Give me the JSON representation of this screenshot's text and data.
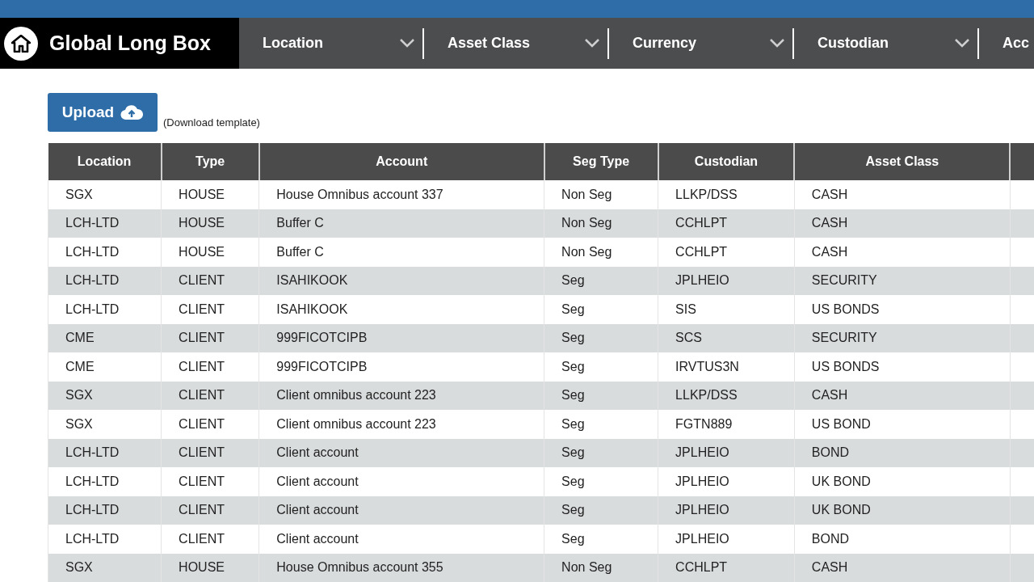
{
  "brand": {
    "title": "Global Long Box"
  },
  "filters": [
    {
      "label": "Location"
    },
    {
      "label": "Asset Class"
    },
    {
      "label": "Currency"
    },
    {
      "label": "Custodian"
    },
    {
      "label": "Acc"
    }
  ],
  "upload": {
    "label": "Upload",
    "link": "(Download template)"
  },
  "table": {
    "columns": [
      "Location",
      "Type",
      "Account",
      "Seg Type",
      "Custodian",
      "Asset Class"
    ],
    "rows": [
      [
        "SGX",
        "HOUSE",
        "House Omnibus account 337",
        "Non Seg",
        "LLKP/DSS",
        "CASH"
      ],
      [
        "LCH-LTD",
        "HOUSE",
        "Buffer C",
        "Non Seg",
        "CCHLPT",
        "CASH"
      ],
      [
        "LCH-LTD",
        "HOUSE",
        "Buffer C",
        "Non Seg",
        "CCHLPT",
        "CASH"
      ],
      [
        "LCH-LTD",
        "CLIENT",
        "ISAHIKOOK",
        "Seg",
        "JPLHEIO",
        "SECURITY"
      ],
      [
        "LCH-LTD",
        "CLIENT",
        "ISAHIKOOK",
        "Seg",
        "SIS",
        "US BONDS"
      ],
      [
        "CME",
        "CLIENT",
        "999FICOTCIPB",
        "Seg",
        "SCS",
        "SECURITY"
      ],
      [
        "CME",
        "CLIENT",
        "999FICOTCIPB",
        "Seg",
        "IRVTUS3N",
        "US BONDS"
      ],
      [
        "SGX",
        "CLIENT",
        "Client omnibus account 223",
        "Seg",
        "LLKP/DSS",
        "CASH"
      ],
      [
        "SGX",
        "CLIENT",
        "Client omnibus account 223",
        "Seg",
        "FGTN889",
        "US BOND"
      ],
      [
        "LCH-LTD",
        "CLIENT",
        "Client account",
        "Seg",
        "JPLHEIO",
        "BOND"
      ],
      [
        "LCH-LTD",
        "CLIENT",
        "Client account",
        "Seg",
        "JPLHEIO",
        "UK BOND"
      ],
      [
        "LCH-LTD",
        "CLIENT",
        "Client account",
        "Seg",
        "JPLHEIO",
        "UK BOND"
      ],
      [
        "LCH-LTD",
        "CLIENT",
        "Client account",
        "Seg",
        "JPLHEIO",
        "BOND"
      ],
      [
        "SGX",
        "HOUSE",
        "House Omnibus account 355",
        "Non Seg",
        "CCHLPT",
        "CASH"
      ]
    ]
  }
}
